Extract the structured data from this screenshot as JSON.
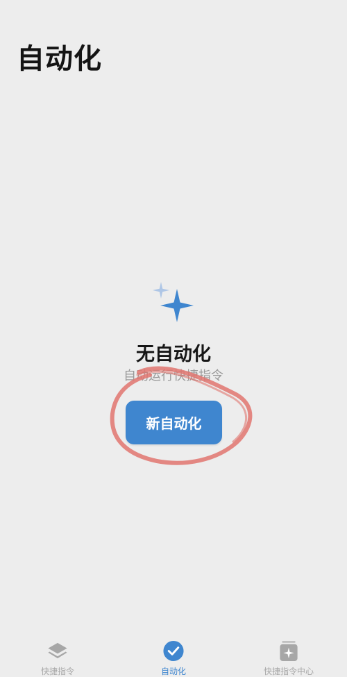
{
  "header": {
    "title": "自动化"
  },
  "empty_state": {
    "icon": "sparkle-icon",
    "title": "无自动化",
    "subtitle": "自动运行快捷指令",
    "button_label": "新自动化"
  },
  "tabbar": {
    "items": [
      {
        "label": "快捷指令",
        "icon": "layers-icon",
        "active": false
      },
      {
        "label": "自动化",
        "icon": "check-clock-icon",
        "active": true
      },
      {
        "label": "快捷指令中心",
        "icon": "gallery-sparkle-icon",
        "active": false
      }
    ]
  },
  "colors": {
    "accent": "#3f86cf",
    "background": "#ededed",
    "inactive_tab": "#a7a7a7",
    "annotation_stroke": "#e0746e"
  }
}
